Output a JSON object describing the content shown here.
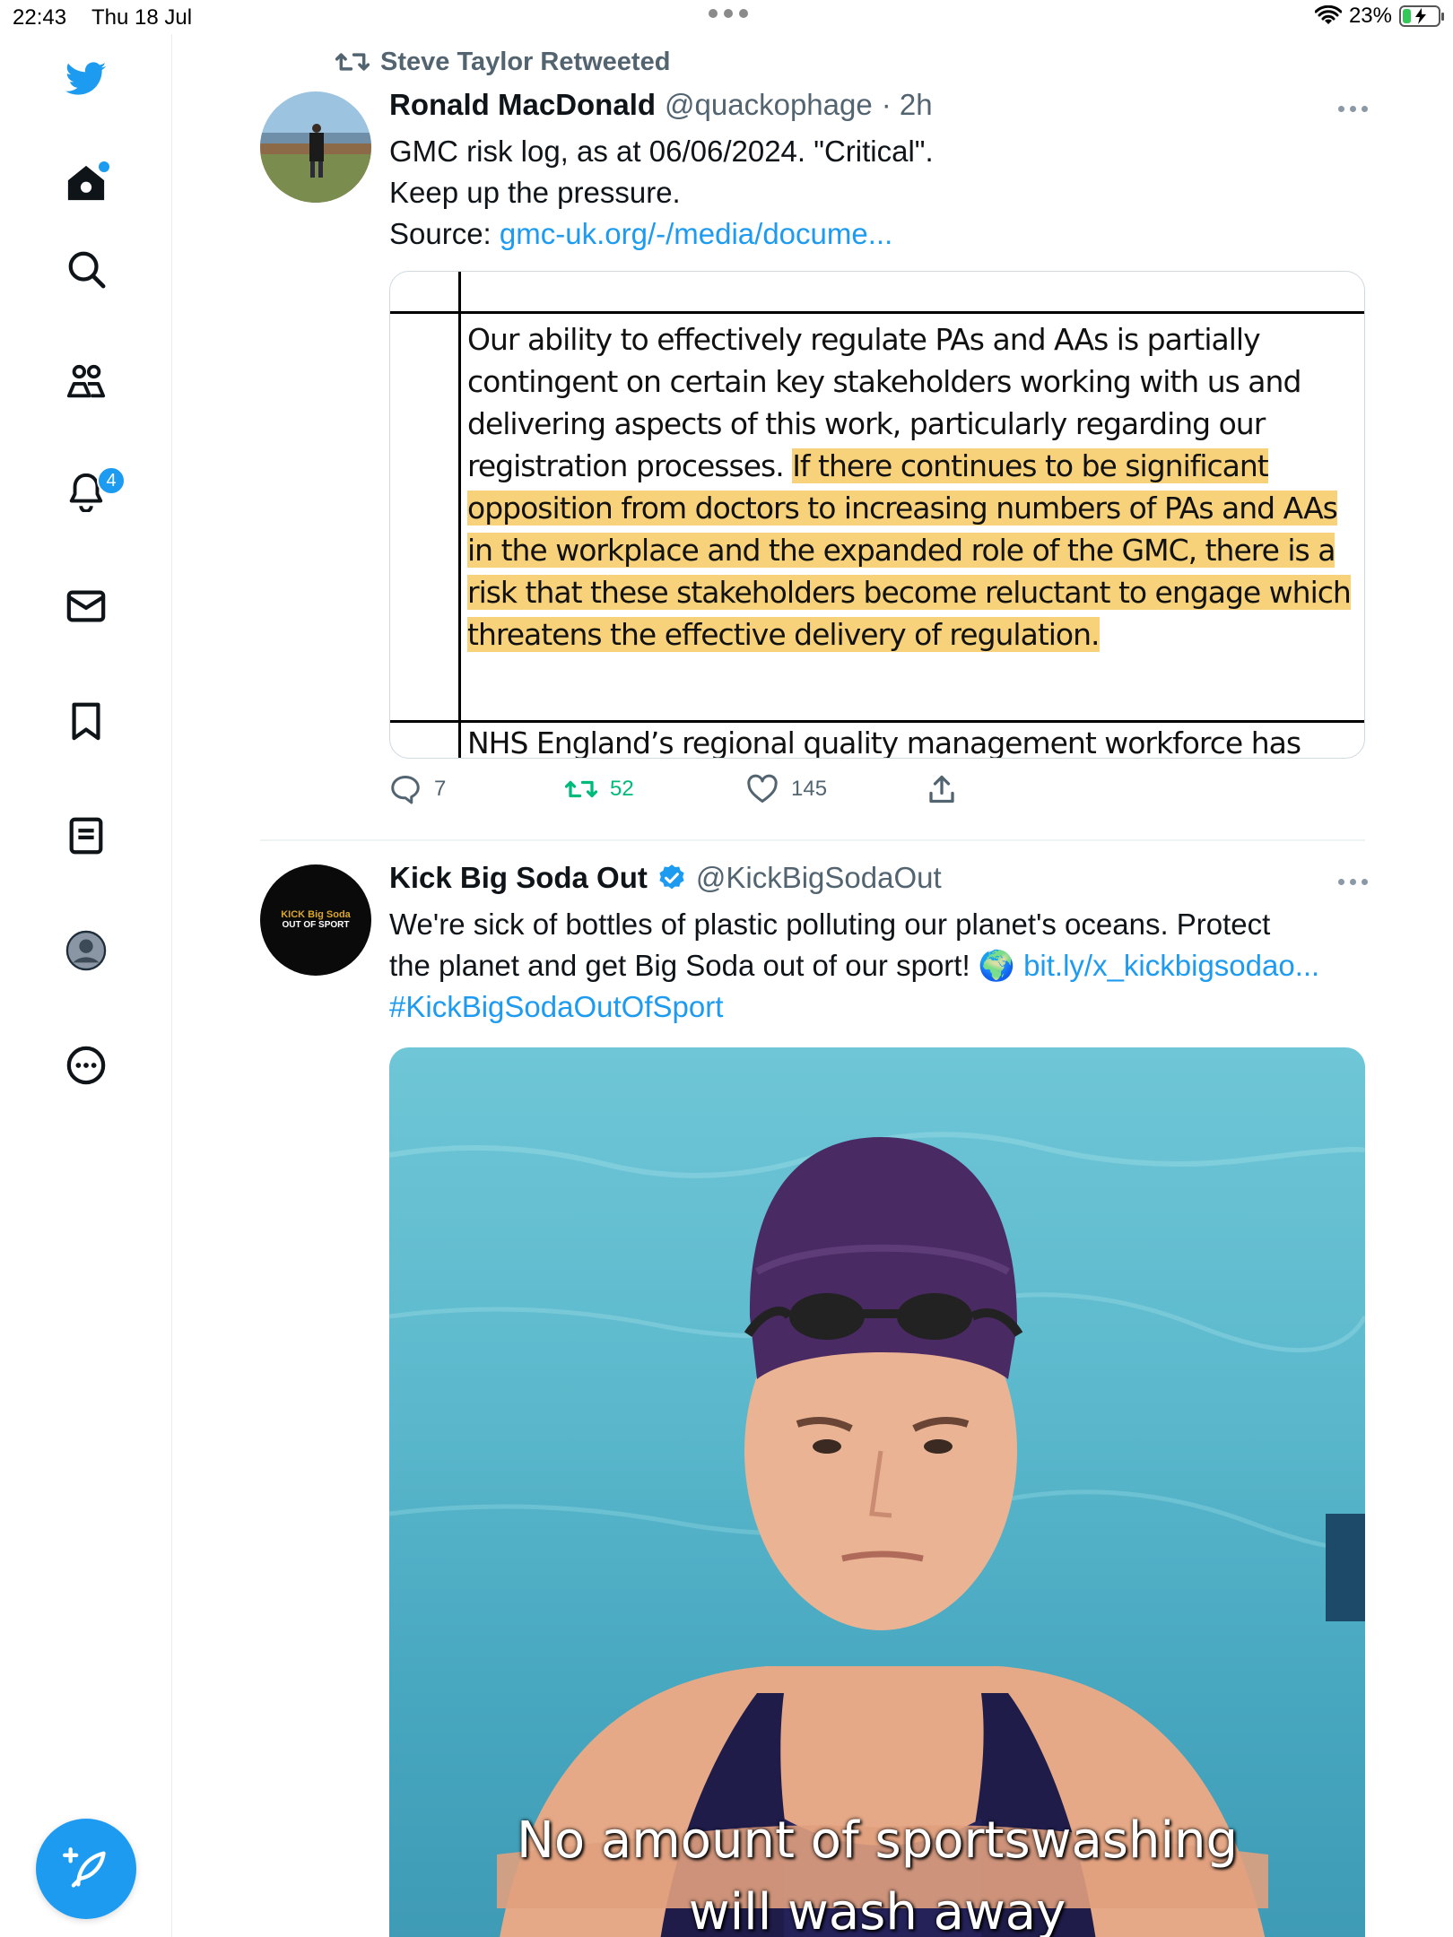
{
  "status_bar": {
    "time": "22:43",
    "date": "Thu 18 Jul",
    "battery": "23%",
    "battery_level": 0.23
  },
  "sidebar": {
    "items": [
      {
        "name": "home",
        "icon": "home-icon"
      },
      {
        "name": "explore",
        "icon": "search-icon"
      },
      {
        "name": "communities",
        "icon": "communities-icon"
      },
      {
        "name": "notifications",
        "icon": "bell-icon",
        "badge": "4"
      },
      {
        "name": "messages",
        "icon": "mail-icon"
      },
      {
        "name": "bookmarks",
        "icon": "bookmark-icon"
      },
      {
        "name": "lists",
        "icon": "list-icon"
      },
      {
        "name": "profile",
        "icon": "avatar-icon"
      },
      {
        "name": "more",
        "icon": "more-circle-icon"
      }
    ],
    "compose_icon": "compose-feather-icon",
    "accent": "#1d9bf0"
  },
  "tweet1": {
    "retweeted_by": "Steve Taylor Retweeted",
    "name": "Ronald MacDonald",
    "handle": "@quackophage",
    "time": "· 2h",
    "text_line1": "GMC risk log, as at 06/06/2024. \"Critical\".",
    "text_line2": "Keep up the pressure.",
    "source_label": "Source:",
    "source_link": "gmc-uk.org/-/media/docume...",
    "doc": {
      "line1": "Our ability to effectively regulate PAs and AAs is partially",
      "line2": "contingent on certain key stakeholders working with us and",
      "line3": "delivering aspects of this work, particularly regarding our",
      "line4_plain": "registration processes.",
      "line4_hl": "If there continues to be significant",
      "line5": "opposition from doctors to increasing numbers of PAs and AAs",
      "line6": "in the workplace and the expanded role of the GMC, there is a",
      "line7": "risk that these stakeholders become reluctant to engage which",
      "line8": "threatens the effective delivery of regulation.",
      "footer": "NHS England’s regional quality management workforce has"
    },
    "replies": "7",
    "retweets": "52",
    "likes": "145"
  },
  "tweet2": {
    "name": "Kick Big Soda Out",
    "handle": "@KickBigSodaOut",
    "text_line1": "We're sick of bottles of plastic polluting our planet's oceans. Protect",
    "text_line2": "the planet and get Big Soda out of our sport! 🌍",
    "link": "bit.ly/x_kickbigsodao...",
    "hashtag": "#KickBigSodaOutOfSport",
    "avatar_text_top": "KICK Big Soda",
    "avatar_text_bottom": "OUT OF SPORT",
    "caption_line1": "No amount of sportswashing",
    "caption_line2": "will wash away"
  }
}
